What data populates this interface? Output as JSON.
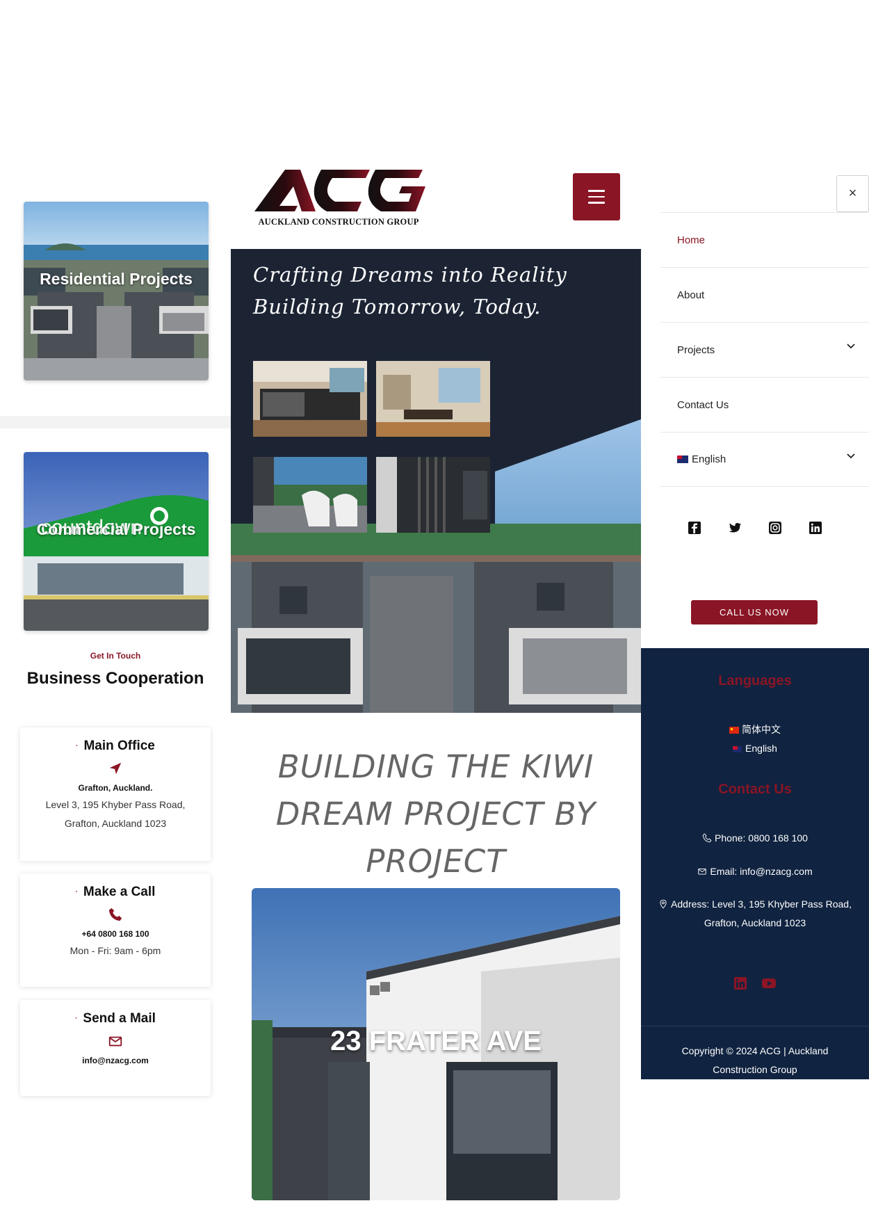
{
  "projects": {
    "residential_title": "Residential Projects",
    "commercial_title": "Commercial Projects"
  },
  "contact": {
    "eyebrow": "Get In Touch",
    "title": "Business Cooperation",
    "office": {
      "heading": "Main Office",
      "bold": "Grafton, Auckland.",
      "line1": "Level 3, 195 Khyber Pass Road,",
      "line2": "Grafton, Auckland 1023"
    },
    "call": {
      "heading": "Make a Call",
      "bold": "+64 0800 168 100",
      "line1": "Mon - Fri: 9am - 6pm"
    },
    "mail": {
      "heading": "Send a Mail",
      "bold": "info@nzacg.com"
    }
  },
  "header": {
    "logo_text": "ACG",
    "logo_subtitle": "AUCKLAND CONSTRUCTION GROUP"
  },
  "hero": {
    "line1": "Crafting Dreams into Reality",
    "line2": "Building Tomorrow, Today."
  },
  "main": {
    "headline": "BUILDING THE KIWI DREAM PROJECT BY PROJECT",
    "featured_project": "23 FRATER AVE"
  },
  "nav": {
    "close": "×",
    "items": [
      {
        "label": "Home",
        "active": true
      },
      {
        "label": "About"
      },
      {
        "label": "Projects",
        "has_submenu": true
      },
      {
        "label": "Contact Us"
      },
      {
        "label": "English",
        "has_submenu": true
      }
    ],
    "socials": [
      "facebook-icon",
      "twitter-icon",
      "instagram-icon",
      "linkedin-icon"
    ],
    "call_button": "CALL US NOW"
  },
  "footer": {
    "languages_heading": "Languages",
    "languages": [
      "简体中文",
      "English"
    ],
    "contact_heading": "Contact Us",
    "phone": "Phone: 0800 168 100",
    "email": "Email: info@nzacg.com",
    "address_line1": "Address: Level 3, 195 Khyber Pass Road,",
    "address_line2": "Grafton, Auckland 1023",
    "socials": [
      "linkedin-icon",
      "youtube-icon"
    ],
    "copyright_line1": "Copyright © 2024 ACG | Auckland",
    "copyright_line2": "Construction Group"
  },
  "colors": {
    "accent": "#8a1525",
    "navy": "#102340",
    "hero_bg": "#1c2434"
  }
}
